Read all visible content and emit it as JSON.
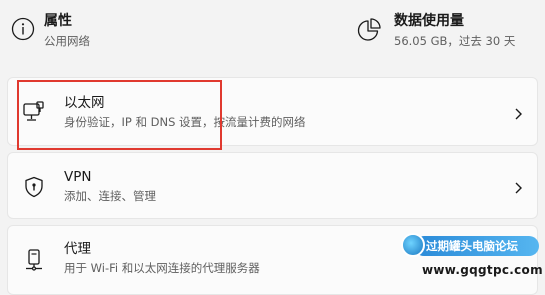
{
  "header": {
    "properties": {
      "title": "属性",
      "subtitle": "公用网络",
      "icon": "info-icon"
    },
    "data_usage": {
      "title": "数据使用量",
      "subtitle": "56.05 GB，过去 30 天",
      "icon": "pie-chart-icon"
    }
  },
  "cards": {
    "ethernet": {
      "title": "以太网",
      "subtitle": "身份验证，IP 和 DNS 设置，按流量计费的网络",
      "icon": "ethernet-icon"
    },
    "vpn": {
      "title": "VPN",
      "subtitle": "添加、连接、管理",
      "icon": "shield-icon"
    },
    "proxy": {
      "title": "代理",
      "subtitle": "用于 Wi-Fi 和以太网连接的代理服务器",
      "icon": "proxy-server-icon"
    }
  },
  "watermark": {
    "name": "过期罐头电脑论坛",
    "url": "www.gqgtpc.com"
  },
  "colors": {
    "highlight": "#e0392f",
    "background": "#f3f3f3",
    "card": "#fbfbfb",
    "watermark": "#2a8ad8"
  }
}
